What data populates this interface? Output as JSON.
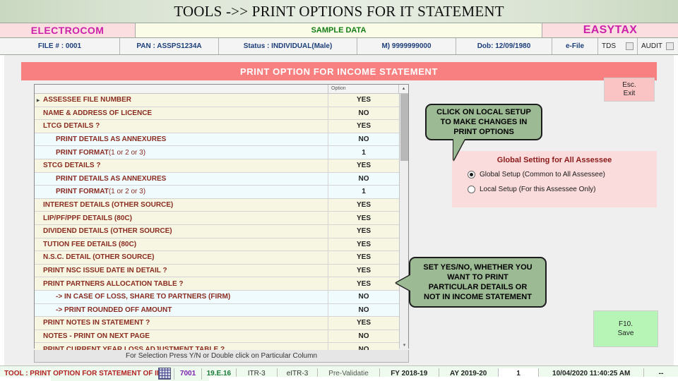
{
  "titlebar": {
    "title": "TOOLS ->> PRINT OPTIONS FOR IT STATEMENT"
  },
  "brand": {
    "left": "ELECTROCOM",
    "middle": "SAMPLE DATA",
    "right": "EASYTAX"
  },
  "info": {
    "file": "FILE # : 0001",
    "pan": "PAN : ASSPS1234A",
    "status": "Status : INDIVIDUAL(Male)",
    "mobile": "M) 9999999000",
    "dob": "Dob: 12/09/1980",
    "efile": "e-File",
    "tds": "TDS",
    "audit": "AUDIT"
  },
  "panel": {
    "header": "PRINT OPTION FOR INCOME STATEMENT",
    "option_column": "Option",
    "footer_hint": "For Selection Press Y/N or Double click on Particular Column"
  },
  "grid_rows": [
    {
      "label": "ASSESSEE FILE NUMBER",
      "value": "YES",
      "level": 0,
      "cursor": true
    },
    {
      "label": "NAME & ADDRESS OF LICENCE",
      "value": "NO",
      "level": 0,
      "cursor": false
    },
    {
      "label": "LTCG DETAILS ?",
      "value": "YES",
      "level": 0,
      "cursor": false
    },
    {
      "label": "PRINT DETAILS AS ANNEXURES",
      "value": "NO",
      "level": 1,
      "cursor": false
    },
    {
      "label": "PRINT FORMAT ",
      "tail": "(1 or 2 or 3)",
      "value": "1",
      "level": 1,
      "cursor": false
    },
    {
      "label": "STCG DETAILS ?",
      "value": "YES",
      "level": 0,
      "cursor": false
    },
    {
      "label": "PRINT DETAILS AS ANNEXURES",
      "value": "NO",
      "level": 1,
      "cursor": false
    },
    {
      "label": "PRINT FORMAT ",
      "tail": "(1 or 2 or 3)",
      "value": "1",
      "level": 1,
      "cursor": false
    },
    {
      "label": "INTEREST DETAILS (OTHER SOURCE)",
      "value": "YES",
      "level": 0,
      "cursor": false
    },
    {
      "label": "LIP/PF/PPF DETAILS (80C)",
      "value": "YES",
      "level": 0,
      "cursor": false
    },
    {
      "label": "DIVIDEND DETAILS (OTHER SOURCE)",
      "value": "YES",
      "level": 0,
      "cursor": false
    },
    {
      "label": "TUTION FEE DETAILS (80C)",
      "value": "YES",
      "level": 0,
      "cursor": false
    },
    {
      "label": "N.S.C. DETAIL (OTHER SOURCE)",
      "value": "YES",
      "level": 0,
      "cursor": false
    },
    {
      "label": "PRINT NSC ISSUE DATE IN DETAIL ?",
      "value": "YES",
      "level": 0,
      "cursor": false
    },
    {
      "label": "PRINT PARTNERS ALLOCATION TABLE ?",
      "value": "YES",
      "level": 0,
      "cursor": false
    },
    {
      "label": "-> IN CASE OF LOSS, SHARE TO PARTNERS (FIRM)",
      "value": "NO",
      "level": 1,
      "cursor": false
    },
    {
      "label": "-> PRINT ROUNDED OFF AMOUNT",
      "value": "NO",
      "level": 1,
      "cursor": false
    },
    {
      "label": "PRINT NOTES IN STATEMENT ?",
      "value": "YES",
      "level": 0,
      "cursor": false
    },
    {
      "label": "NOTES - PRINT ON NEXT PAGE",
      "value": "NO",
      "level": 0,
      "cursor": false
    },
    {
      "label": "PRINT CURRENT YEAR LOSS ADJUSTMENT TABLE ?",
      "value": "NO",
      "level": 0,
      "cursor": false
    }
  ],
  "esc_button": {
    "line1": "Esc.",
    "line2": "Exit"
  },
  "callouts": {
    "local_setup": [
      "CLICK ON LOCAL SETUP",
      "TO MAKE CHANGES IN",
      "PRINT OPTIONS"
    ],
    "yes_no": [
      "SET YES/NO, WHETHER YOU",
      "WANT TO PRINT",
      "PARTICULAR DETAILS OR",
      "NOT IN INCOME STATEMENT"
    ]
  },
  "global_setting": {
    "title": "Global Setting for All Assessee",
    "option_global": "Global Setup (Common to All Assessee)",
    "option_local": "Local Setup (For this Assessee Only)",
    "selected": "global"
  },
  "save_button": {
    "line1": "F10.",
    "line2": "Save"
  },
  "statusbar": {
    "title": "TOOL : PRINT OPTION FOR STATEMENT OF INCOME A",
    "code": "7001",
    "version": "19.E.16",
    "itr": "ITR-3",
    "eitr": "eITR-3",
    "prevalidate": "Pre-Validatie",
    "fy": "FY 2018-19",
    "ay": "AY 2019-20",
    "count": "1",
    "datetime": "10/04/2020 11:40:25 AM",
    "end": "--"
  },
  "colors": {
    "accent_pink": "#f98080",
    "brand_magenta": "#cc22aa",
    "callout_green": "#9cba94",
    "save_green": "#b6f5b6",
    "row_main": "#f7f6e2",
    "row_sub": "#f0fbfd"
  }
}
